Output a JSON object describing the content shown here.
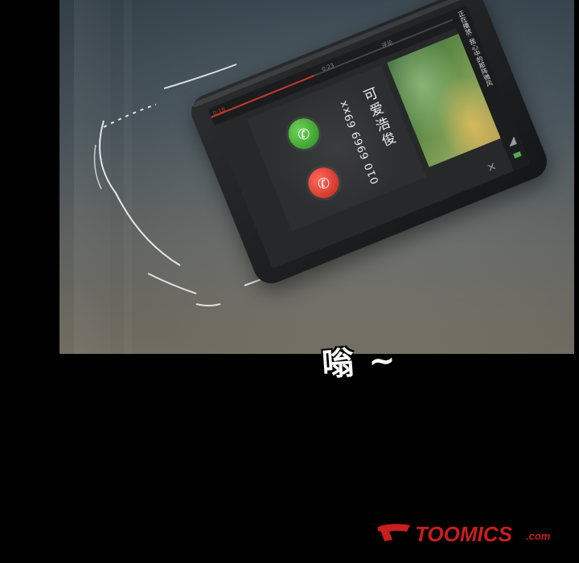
{
  "phone": {
    "now_playing": "正在播放: 我心中的那阵微风",
    "caller_number": "010 6969 69xx",
    "caller_name": "可爱浩俊",
    "time_elapsed": "0:18",
    "time_total": "0:23",
    "comment_label": "评论",
    "accept_icon": "phone-accept-icon",
    "decline_icon": "phone-decline-icon",
    "progress": 0.4
  },
  "sfx_text": "嗡 ~",
  "watermark": {
    "brand": "TOOMICS",
    "tld": ".com",
    "color": "#c81e1e"
  }
}
